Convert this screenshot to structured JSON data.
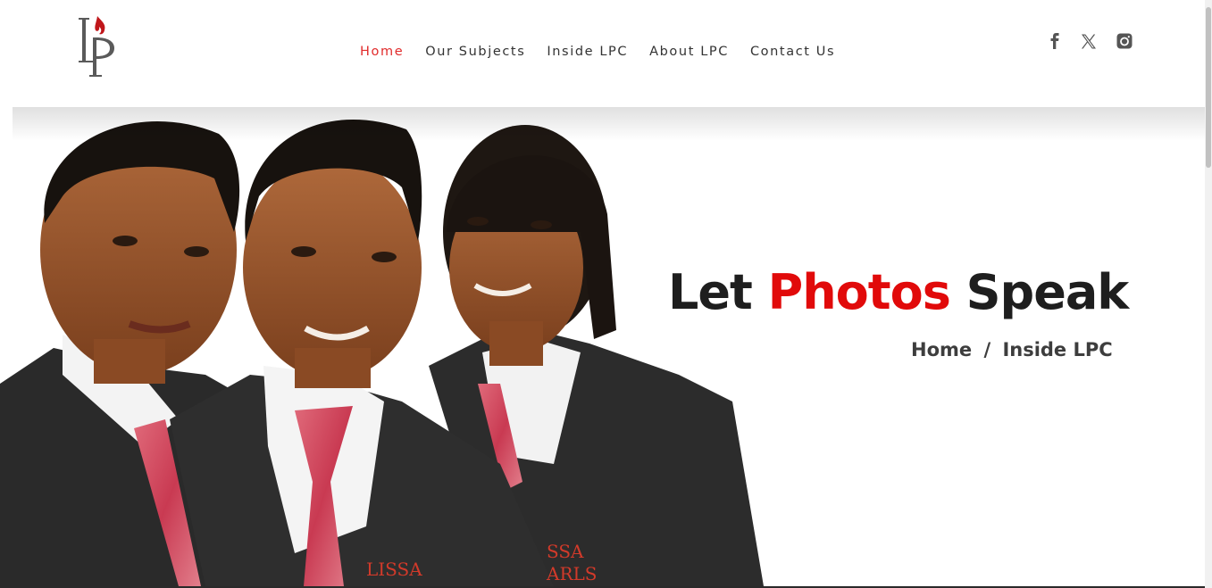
{
  "brand": {
    "logo_text": "LP"
  },
  "nav": {
    "items": [
      {
        "label": "Home",
        "active": true
      },
      {
        "label": "Our Subjects",
        "active": false
      },
      {
        "label": "Inside LPC",
        "active": false
      },
      {
        "label": "About LPC",
        "active": false
      },
      {
        "label": "Contact Us",
        "active": false
      }
    ]
  },
  "social": [
    {
      "icon": "facebook-icon"
    },
    {
      "icon": "x-twitter-icon"
    },
    {
      "icon": "instagram-icon"
    }
  ],
  "hero": {
    "title_part1": "Let ",
    "title_accent": "Photos",
    "title_part2": " Speak",
    "breadcrumb": {
      "home": "Home",
      "separator": "/",
      "current": "Inside LPC"
    }
  },
  "colors": {
    "accent": "#e10a0a",
    "nav_active": "#e12b2b",
    "text": "#1e1e1e"
  }
}
